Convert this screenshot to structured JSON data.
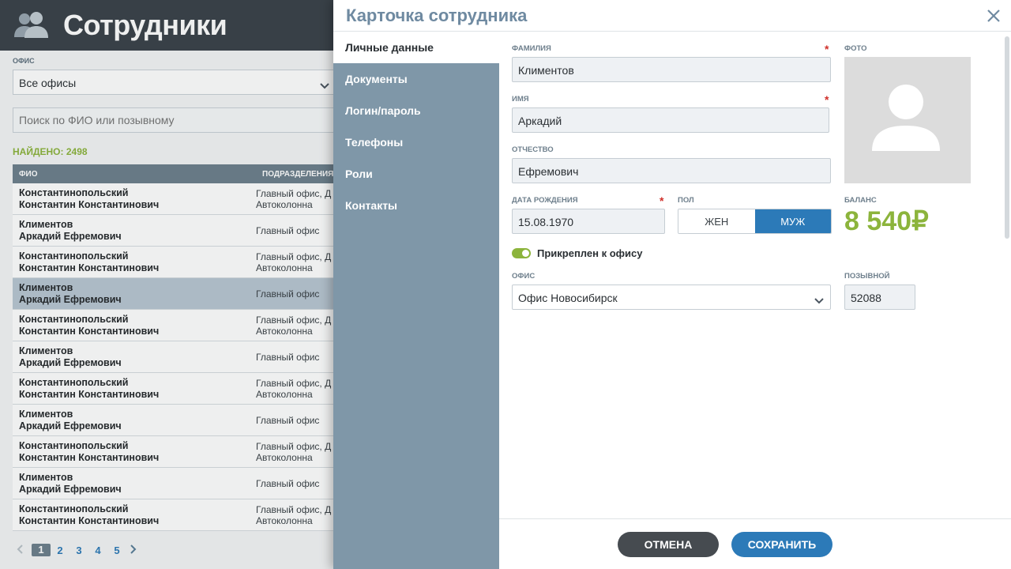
{
  "list_page": {
    "title": "Сотрудники",
    "office_filter_label": "ОФИС",
    "office_filter_value": "Все офисы",
    "search_placeholder": "Поиск по ФИО или позывному",
    "found_label": "НАЙДЕНО: 2498",
    "columns": {
      "name": "ФИО",
      "departments": "ПОДРАЗДЕЛЕНИЯ"
    },
    "rows": [
      {
        "surname": "Константинопольский",
        "given": "Константин Константинович",
        "dept1": "Главный офис, Д",
        "dept2": "Автоколонна",
        "selected": false
      },
      {
        "surname": "Климентов",
        "given": "Аркадий Ефремович",
        "dept1": "Главный офис",
        "dept2": "",
        "selected": false
      },
      {
        "surname": "Константинопольский",
        "given": "Константин Константинович",
        "dept1": "Главный офис, Д",
        "dept2": "Автоколонна",
        "selected": false
      },
      {
        "surname": "Климентов",
        "given": "Аркадий Ефремович",
        "dept1": "Главный офис",
        "dept2": "",
        "selected": true
      },
      {
        "surname": "Константинопольский",
        "given": "Константин Константинович",
        "dept1": "Главный офис, Д",
        "dept2": "Автоколонна",
        "selected": false
      },
      {
        "surname": "Климентов",
        "given": "Аркадий Ефремович",
        "dept1": "Главный офис",
        "dept2": "",
        "selected": false
      },
      {
        "surname": "Константинопольский",
        "given": "Константин Константинович",
        "dept1": "Главный офис, Д",
        "dept2": "Автоколонна",
        "selected": false
      },
      {
        "surname": "Климентов",
        "given": "Аркадий Ефремович",
        "dept1": "Главный офис",
        "dept2": "",
        "selected": false
      },
      {
        "surname": "Константинопольский",
        "given": "Константин Константинович",
        "dept1": "Главный офис, Д",
        "dept2": "Автоколонна",
        "selected": false
      },
      {
        "surname": "Климентов",
        "given": "Аркадий Ефремович",
        "dept1": "Главный офис",
        "dept2": "",
        "selected": false
      },
      {
        "surname": "Константинопольский",
        "given": "Константин Константинович",
        "dept1": "Главный офис, Д",
        "dept2": "Автоколонна",
        "selected": false
      }
    ],
    "pagination": {
      "pages": [
        "1",
        "2",
        "3",
        "4",
        "5"
      ],
      "current": "1"
    }
  },
  "modal": {
    "title": "Карточка сотрудника",
    "tabs": [
      "Личные данные",
      "Документы",
      "Логин/пароль",
      "Телефоны",
      "Роли",
      "Контакты"
    ],
    "active_tab": "Личные данные",
    "fields": {
      "surname_label": "ФАМИЛИЯ",
      "surname_value": "Климентов",
      "name_label": "ИМЯ",
      "name_value": "Аркадий",
      "patronymic_label": "ОТЧЕСТВО",
      "patronymic_value": "Ефремович",
      "birthdate_label": "ДАТА РОЖДЕНИЯ",
      "birthdate_value": "15.08.1970",
      "sex_label": "ПОЛ",
      "sex_female": "ЖЕН",
      "sex_male": "МУЖ",
      "sex_selected": "МУЖ",
      "photo_label": "ФОТО",
      "balance_label": "БАЛАНС",
      "balance_value": "8 540₽",
      "attached_label": "Прикреплен к офису",
      "attached_on": true,
      "office_label": "ОФИС",
      "office_value": "Офис Новосибирск",
      "callsign_label": "ПОЗЫВНОЙ",
      "callsign_value": "52088",
      "required_mark": "*"
    },
    "buttons": {
      "cancel": "ОТМЕНА",
      "save": "СОХРАНИТЬ"
    }
  },
  "colors": {
    "header_dark": "#3a4249",
    "accent_blue": "#2c7ab8",
    "accent_green": "#8cb43c",
    "tabs_bg": "#7f97a8",
    "required": "#d0302a"
  },
  "icons": [
    "users-icon",
    "chevron-down-icon",
    "close-icon",
    "avatar-placeholder-icon",
    "chevron-left-icon",
    "chevron-right-icon"
  ]
}
